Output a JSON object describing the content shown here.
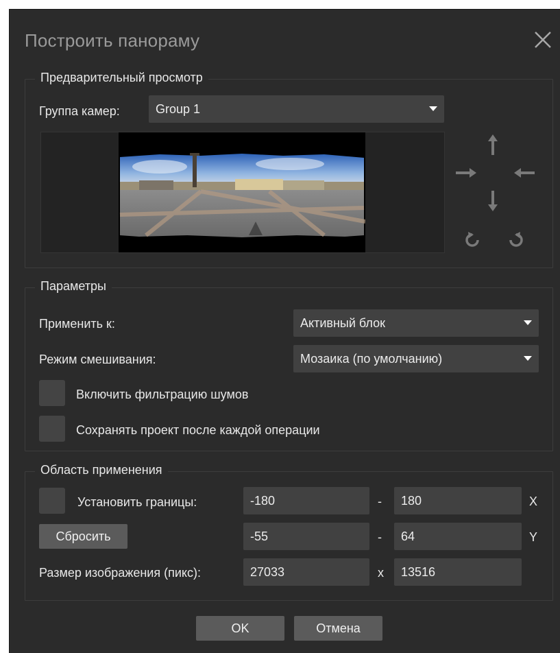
{
  "dialog": {
    "title": "Построить панораму"
  },
  "preview": {
    "legend": "Предварительный просмотр",
    "camera_group_label": "Группа камер:",
    "camera_group_value": "Group 1"
  },
  "params": {
    "legend": "Параметры",
    "apply_to_label": "Применить к:",
    "apply_to_value": "Активный блок",
    "blend_mode_label": "Режим смешивания:",
    "blend_mode_value": "Мозаика (по умолчанию)",
    "noise_filter_label": "Включить фильтрацию шумов",
    "noise_filter_checked": false,
    "save_project_label": "Сохранять проект после каждой операции",
    "save_project_checked": false
  },
  "region": {
    "legend": "Область применения",
    "set_bounds_label": "Установить границы:",
    "set_bounds_checked": false,
    "reset_label": "Сбросить",
    "x_min": "-180",
    "x_max": "180",
    "x_axis": "X",
    "y_min": "-55",
    "y_max": "64",
    "y_axis": "Y",
    "dash": "-",
    "image_size_label": "Размер изображения (пикс):",
    "width": "27033",
    "height": "13516",
    "times": "x"
  },
  "buttons": {
    "ok": "OK",
    "cancel": "Отмена"
  },
  "icons": {
    "close": "close-icon",
    "pan_up": "arrow-up-icon",
    "pan_left": "arrow-right-icon",
    "pan_right": "arrow-left-icon",
    "pan_down": "arrow-down-icon",
    "rotate_ccw": "rotate-ccw-icon",
    "rotate_cw": "rotate-cw-icon"
  },
  "colors": {
    "background": "#2b2b2b",
    "control": "#414141",
    "button": "#5b5b5b"
  }
}
